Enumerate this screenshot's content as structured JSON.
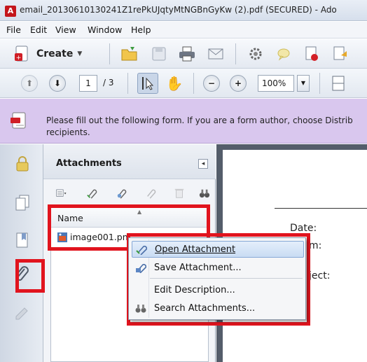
{
  "window": {
    "title": "email_20130610130241Z1rePkUJqtyMtNGBnGyKw (2).pdf (SECURED) - Ado",
    "app_icon_glyph": "A"
  },
  "menu": {
    "items": [
      "File",
      "Edit",
      "View",
      "Window",
      "Help"
    ]
  },
  "toolbar": {
    "create_label": "Create",
    "create_caret": "▼"
  },
  "page_nav": {
    "current_page": "1",
    "total_pages": "/ 3",
    "zoom": "100%",
    "zoom_caret": "▼"
  },
  "infobar": {
    "message": "Please fill out the following form. If you are a form author, choose Distrib recipients."
  },
  "attachments_panel": {
    "title": "Attachments",
    "collapse_glyph": "◂",
    "column_name": "Name",
    "sort_glyph": "▲",
    "file": {
      "name": "image001.pn"
    }
  },
  "context_menu": {
    "items": [
      {
        "label": "Open Attachment"
      },
      {
        "label": "Save Attachment..."
      },
      {
        "label": "Edit Description..."
      },
      {
        "label": "Search Attachments..."
      }
    ]
  },
  "document": {
    "date_label": "Date:",
    "from_label": "m:",
    "subject_label": "ject:"
  },
  "colors": {
    "highlight_red": "#e1141e",
    "infobar_purple": "#d9c7ee",
    "menu_hover_blue": "#c9dcf3"
  }
}
